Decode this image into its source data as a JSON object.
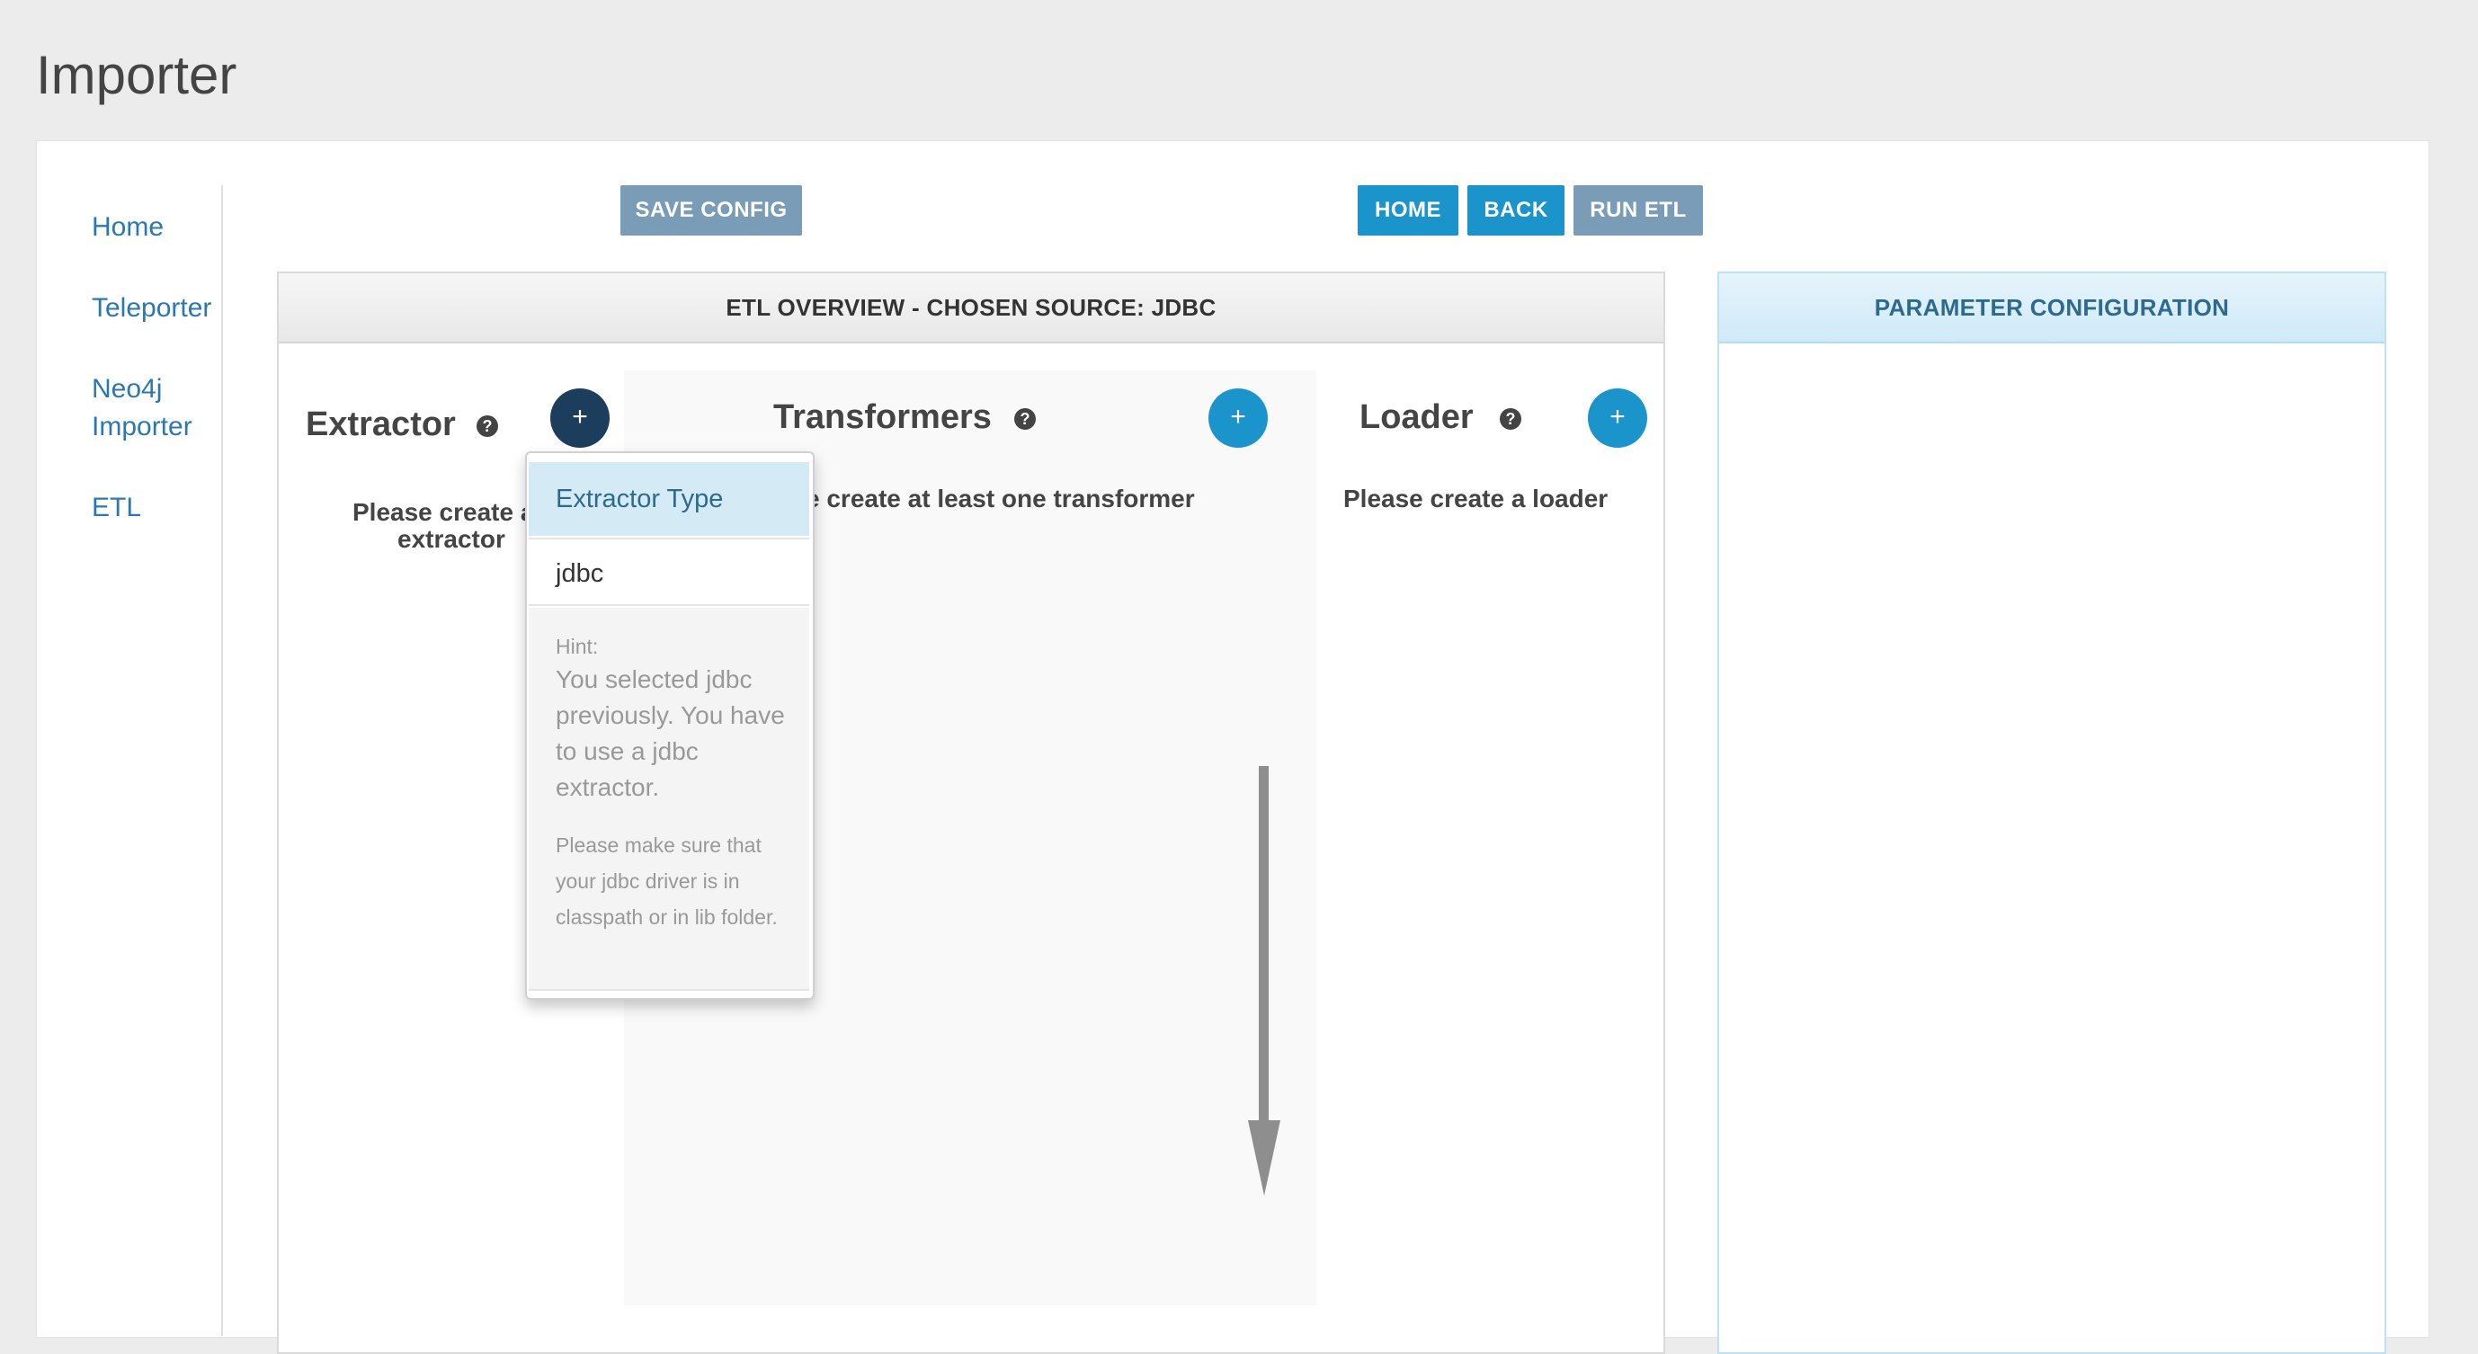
{
  "page": {
    "title": "Importer"
  },
  "sidebar": {
    "items": [
      {
        "label": "Home"
      },
      {
        "label": "Teleporter"
      },
      {
        "label": "Neo4j Importer"
      },
      {
        "label": "ETL"
      }
    ]
  },
  "toolbar": {
    "save_config": "SAVE CONFIG",
    "home": "HOME",
    "back": "BACK",
    "run_etl": "RUN ETL"
  },
  "etl_overview": {
    "header": "ETL OVERVIEW - CHOSEN SOURCE: JDBC",
    "extractor": {
      "title": "Extractor",
      "placeholder_line1": "Please create a",
      "placeholder_line2": "extractor",
      "add_icon": "+"
    },
    "transformers": {
      "title": "Transformers",
      "placeholder": "e create at least one transformer",
      "add_icon": "+"
    },
    "loader": {
      "title": "Loader",
      "placeholder": "Please create a loader",
      "add_icon": "+"
    },
    "help_icon": "?"
  },
  "dropdown": {
    "header": "Extractor Type",
    "options": [
      "jdbc"
    ],
    "hint_label": "Hint:",
    "hint_text": "You selected jdbc previously. You have to use a jdbc extractor.",
    "hint_note": "Please make sure that your jdbc driver is in classpath or in lib folder."
  },
  "parameter_configuration": {
    "header": "PARAMETER CONFIGURATION"
  },
  "colors": {
    "accent_blue": "#1b94cc",
    "button_grey": "#7a9cb6",
    "link_blue": "#2b78b0",
    "dark_navy": "#1d3d5c"
  }
}
